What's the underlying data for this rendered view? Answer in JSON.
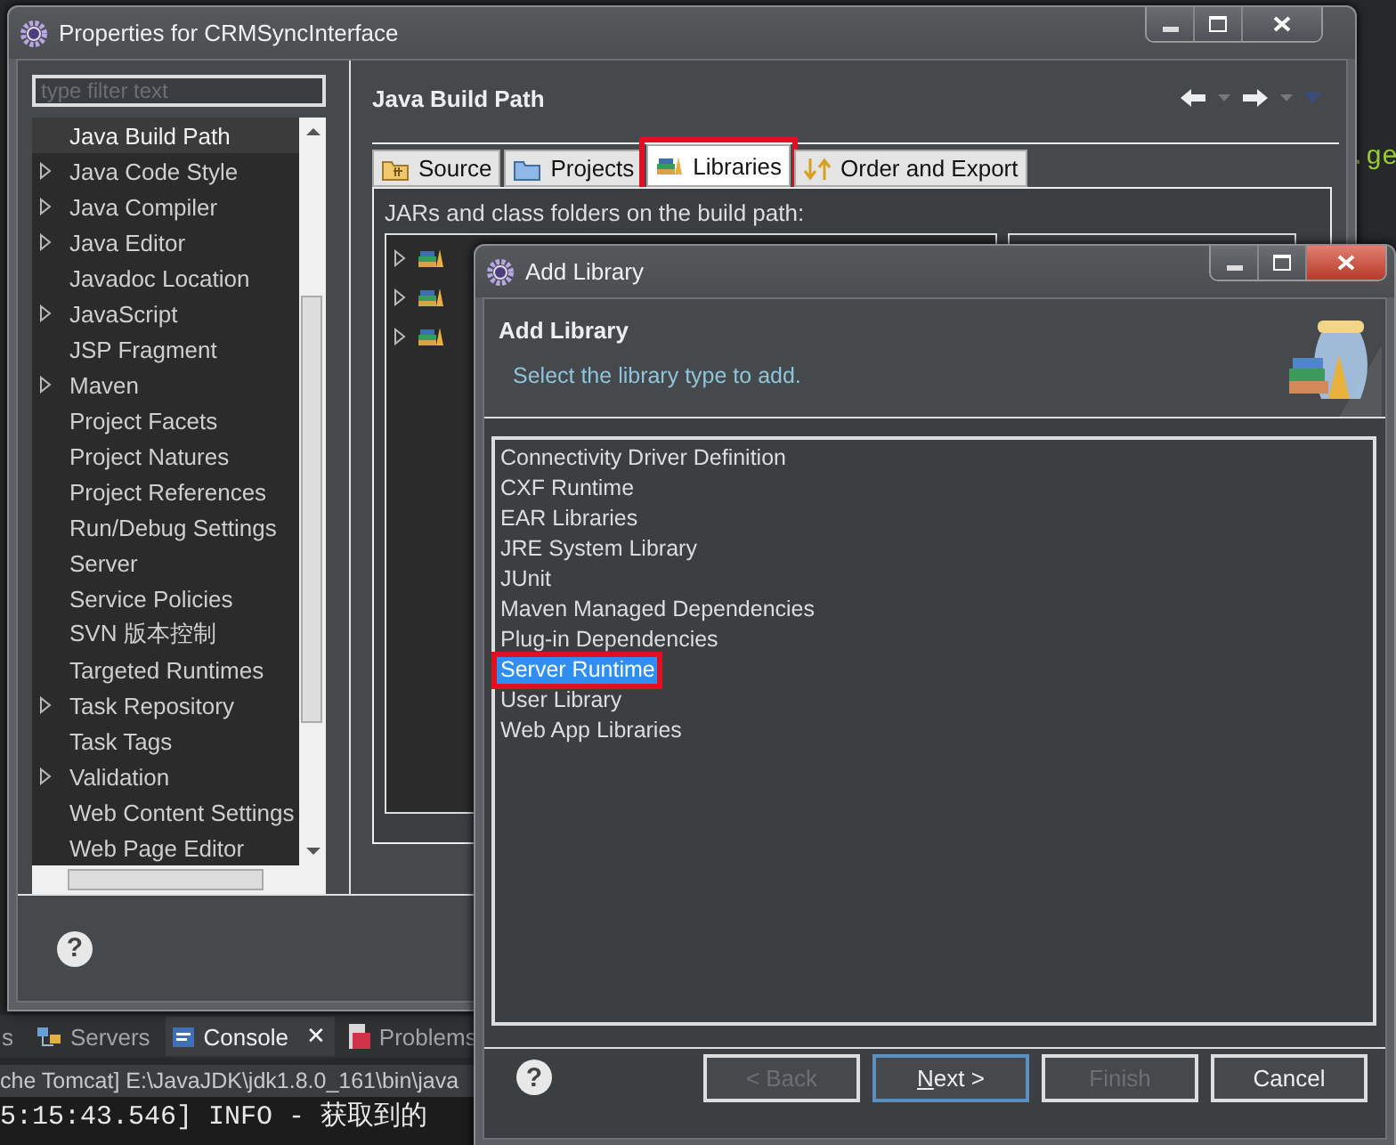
{
  "editor": {
    "code_fragment": ".ge"
  },
  "properties_window": {
    "title": "Properties for CRMSyncInterface",
    "filter": {
      "placeholder": "type filter text"
    },
    "tree": [
      {
        "label": "Java Build Path",
        "expandable": false,
        "selected": true
      },
      {
        "label": "Java Code Style",
        "expandable": true,
        "selected": false
      },
      {
        "label": "Java Compiler",
        "expandable": true,
        "selected": false
      },
      {
        "label": "Java Editor",
        "expandable": true,
        "selected": false
      },
      {
        "label": "Javadoc Location",
        "expandable": false,
        "selected": false
      },
      {
        "label": "JavaScript",
        "expandable": true,
        "selected": false
      },
      {
        "label": "JSP Fragment",
        "expandable": false,
        "selected": false
      },
      {
        "label": "Maven",
        "expandable": true,
        "selected": false
      },
      {
        "label": "Project Facets",
        "expandable": false,
        "selected": false
      },
      {
        "label": "Project Natures",
        "expandable": false,
        "selected": false
      },
      {
        "label": "Project References",
        "expandable": false,
        "selected": false
      },
      {
        "label": "Run/Debug Settings",
        "expandable": false,
        "selected": false
      },
      {
        "label": "Server",
        "expandable": false,
        "selected": false
      },
      {
        "label": "Service Policies",
        "expandable": false,
        "selected": false
      },
      {
        "label": "SVN 版本控制",
        "expandable": false,
        "selected": false
      },
      {
        "label": "Targeted Runtimes",
        "expandable": false,
        "selected": false
      },
      {
        "label": "Task Repository",
        "expandable": true,
        "selected": false
      },
      {
        "label": "Task Tags",
        "expandable": false,
        "selected": false
      },
      {
        "label": "Validation",
        "expandable": true,
        "selected": false
      },
      {
        "label": "Web Content Settings",
        "expandable": false,
        "selected": false
      },
      {
        "label": "Web Page Editor",
        "expandable": false,
        "selected": false
      }
    ],
    "page_title": "Java Build Path",
    "tabs": [
      {
        "label": "Source",
        "kind": "source",
        "selected": false,
        "highlighted": false
      },
      {
        "label": "Projects",
        "kind": "projects",
        "selected": false,
        "highlighted": false
      },
      {
        "label": "Libraries",
        "kind": "libraries",
        "selected": true,
        "highlighted": true
      },
      {
        "label": "Order and Export",
        "kind": "order",
        "selected": false,
        "highlighted": false
      }
    ],
    "build_path_label": "JARs and class folders on the build path:",
    "build_path_entries": [
      {
        "expanded": false
      },
      {
        "expanded": false
      },
      {
        "expanded": false
      }
    ],
    "help_glyph": "?"
  },
  "add_library_dialog": {
    "title": "Add Library",
    "heading": "Add Library",
    "subtitle": "Select the library type to add.",
    "items": [
      {
        "label": "Connectivity Driver Definition",
        "selected": false,
        "highlighted": false
      },
      {
        "label": "CXF Runtime",
        "selected": false,
        "highlighted": false
      },
      {
        "label": "EAR Libraries",
        "selected": false,
        "highlighted": false
      },
      {
        "label": "JRE System Library",
        "selected": false,
        "highlighted": false
      },
      {
        "label": "JUnit",
        "selected": false,
        "highlighted": false
      },
      {
        "label": "Maven Managed Dependencies",
        "selected": false,
        "highlighted": false
      },
      {
        "label": "Plug-in Dependencies",
        "selected": false,
        "highlighted": false
      },
      {
        "label": "Server Runtime",
        "selected": true,
        "highlighted": true
      },
      {
        "label": "User Library",
        "selected": false,
        "highlighted": false
      },
      {
        "label": "Web App Libraries",
        "selected": false,
        "highlighted": false
      }
    ],
    "help_glyph": "?",
    "buttons": [
      {
        "label": "< Back",
        "disabled": true,
        "focused": false
      },
      {
        "label": "**N**ext >",
        "disabled": false,
        "focused": true
      },
      {
        "label": "Finish",
        "disabled": true,
        "focused": false
      },
      {
        "label": "Cancel",
        "disabled": false,
        "focused": false
      }
    ]
  },
  "bottom_panel": {
    "tabs": [
      {
        "label": "s",
        "kind": "plain",
        "selected": false
      },
      {
        "label": "Servers",
        "kind": "servers",
        "selected": false
      },
      {
        "label": "Console",
        "kind": "console",
        "selected": true,
        "close_glyph": "✕"
      },
      {
        "label": "Problems",
        "kind": "problems",
        "selected": false
      }
    ],
    "console_path": "che Tomcat] E:\\JavaJDK\\jdk1.8.0_161\\bin\\java",
    "console_line": "5:15:43.546] INFO - 获取到的"
  }
}
